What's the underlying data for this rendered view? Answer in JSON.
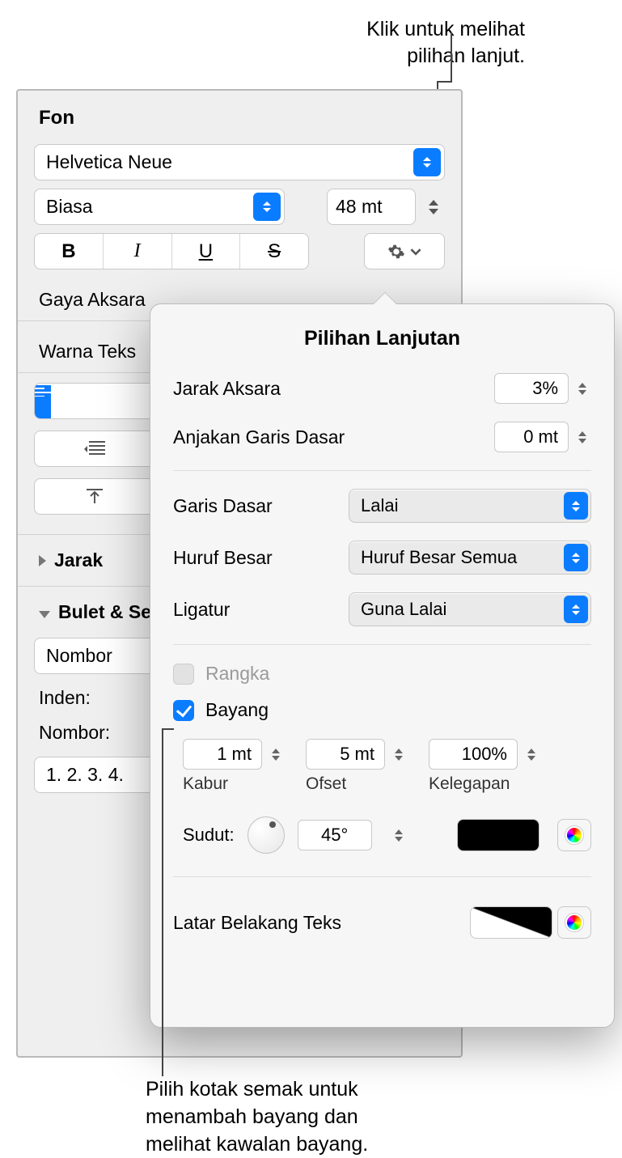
{
  "callouts": {
    "top": "Klik untuk melihat\npilihan lanjut.",
    "bottom": "Pilih kotak semak untuk\nmenambah bayang dan\nmelihat kawalan bayang."
  },
  "font_section": {
    "title": "Fon",
    "family": "Helvetica Neue",
    "style": "Biasa",
    "size": "48 mt"
  },
  "labels": {
    "gaya_aksara": "Gaya Aksara",
    "warna_teks": "Warna Teks",
    "jarak": "Jarak",
    "bulet": "Bulet & Se",
    "nombor_select": "Nombor",
    "inden": "Inden:",
    "nombor": "Nombor:",
    "numbering_preview": "1. 2. 3. 4."
  },
  "popover": {
    "title": "Pilihan Lanjutan",
    "char_spacing_label": "Jarak Aksara",
    "char_spacing_value": "3%",
    "baseline_shift_label": "Anjakan Garis Dasar",
    "baseline_shift_value": "0 mt",
    "baseline_label": "Garis Dasar",
    "baseline_value": "Lalai",
    "caps_label": "Huruf Besar",
    "caps_value": "Huruf Besar Semua",
    "ligature_label": "Ligatur",
    "ligature_value": "Guna Lalai",
    "outline_label": "Rangka",
    "shadow_label": "Bayang",
    "shadow": {
      "blur_value": "1 mt",
      "blur_label": "Kabur",
      "offset_value": "5 mt",
      "offset_label": "Ofset",
      "opacity_value": "100%",
      "opacity_label": "Kelegapan",
      "angle_label": "Sudut:",
      "angle_value": "45°"
    },
    "text_bg_label": "Latar Belakang Teks"
  }
}
